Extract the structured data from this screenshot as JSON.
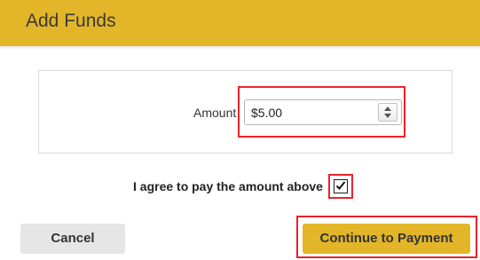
{
  "dialog": {
    "title": "Add Funds"
  },
  "amount": {
    "label": "Amount",
    "value": "$5.00"
  },
  "agreement": {
    "label": "I agree to pay the amount above",
    "checked": true
  },
  "actions": {
    "cancel_label": "Cancel",
    "continue_label": "Continue to Payment"
  },
  "colors": {
    "header": "#e2b628",
    "primary_button": "#e2b628",
    "secondary_button": "#e6e6e6",
    "highlight": "#e8232a"
  },
  "icons": {
    "spinner": "up-down-spinner-icon",
    "checkbox": "checkmark-icon"
  }
}
